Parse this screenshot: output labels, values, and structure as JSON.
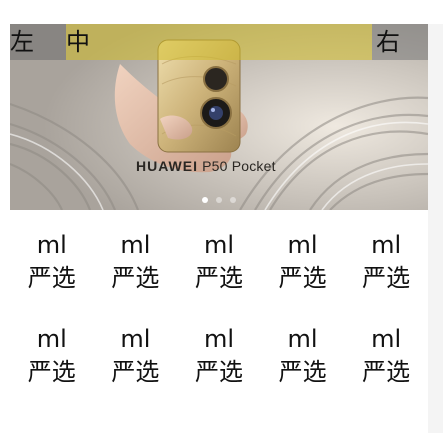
{
  "header": {
    "left_label": "左",
    "center_label": "中",
    "right_label": "右"
  },
  "banner": {
    "brand": "HUAWEI",
    "model": "P50 Pocket",
    "slides_total": 3,
    "active_slide": 1
  },
  "grid": {
    "items": [
      {
        "top": "ml",
        "bottom": "严选"
      },
      {
        "top": "ml",
        "bottom": "严选"
      },
      {
        "top": "ml",
        "bottom": "严选"
      },
      {
        "top": "ml",
        "bottom": "严选"
      },
      {
        "top": "ml",
        "bottom": "严选"
      },
      {
        "top": "ml",
        "bottom": "严选"
      },
      {
        "top": "ml",
        "bottom": "严选"
      },
      {
        "top": "ml",
        "bottom": "严选"
      },
      {
        "top": "ml",
        "bottom": "严选"
      },
      {
        "top": "ml",
        "bottom": "严选"
      }
    ]
  }
}
